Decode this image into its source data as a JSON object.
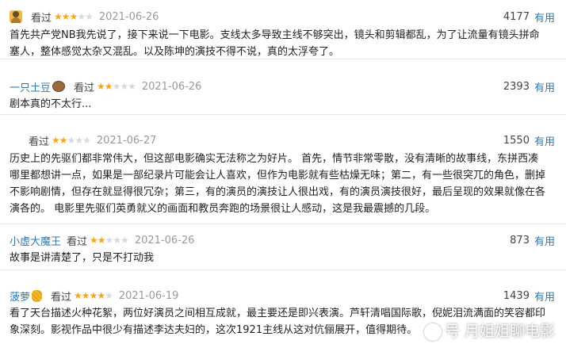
{
  "reviews": [
    {
      "username": "",
      "avatar": "person-avatar",
      "status": "看过",
      "rating": 3,
      "date": "2021-06-26",
      "votes": "4177",
      "useful_label": "有用",
      "content": "首先共产党NB我先说了，接下来说一下电影。支线太多导致主线不够突出，镜头和剪辑都乱，为了让流量有镜头拼命塞人，整体感觉太杂又混乱。以及陈坤的演技不得不说，真的太浮夸了。"
    },
    {
      "username": "一只土豆",
      "avatar": "potato-avatar",
      "status": "看过",
      "rating": 2,
      "date": "2021-06-26",
      "votes": "2393",
      "useful_label": "有用",
      "content": "剧本真的不太行..."
    },
    {
      "username": "",
      "avatar": "",
      "status": "看过",
      "rating": 2,
      "date": "2021-06-27",
      "votes": "1550",
      "useful_label": "有用",
      "content": "历史上的先驱们都非常伟大，但这部电影确实无法称之为好片。 首先，情节非常零散，没有清晰的故事线，东拼西凑哪里都想讲一点，如果是一部纪录片可能会让人喜欢，但作为电影就有些枯燥无味；第二，有一些很突兀的角色，删掉不影响剧情，但存在就显得很冗杂；第三，有的演员的演技让人很出戏，有的演员演技很好，最后呈现的效果就像在各演各的。 电影里先驱们英勇就义的画面和教员奔跑的场景很让人感动，这是我最震撼的几段。"
    },
    {
      "username": "小虚大魔王",
      "avatar": "",
      "status": "看过",
      "rating": 2,
      "date": "2021-06-26",
      "votes": "873",
      "useful_label": "有用",
      "content": "故事是讲清楚了，只是不打动我"
    },
    {
      "username": "菠萝",
      "avatar": "pineapple-avatar",
      "status": "看过",
      "rating": 4,
      "date": "2021-06-19",
      "votes": "1439",
      "useful_label": "有用",
      "content": "看了天台描述火种花絮，两位好演员之间相互成就，最主要还是即兴表演。芦轩清唱国际歌，倪妮泪流满面的笑容都印象深刻。影视作品中很少有描述李达夫妇的，这次1921主线从这对伉俪展开，值得期待。"
    }
  ],
  "watermark": {
    "text": "号 月姐姐聊电影"
  },
  "colors": {
    "link": "#3377aa",
    "star": "#f5a623",
    "star_empty": "#d9d9d9",
    "date": "#999999"
  }
}
